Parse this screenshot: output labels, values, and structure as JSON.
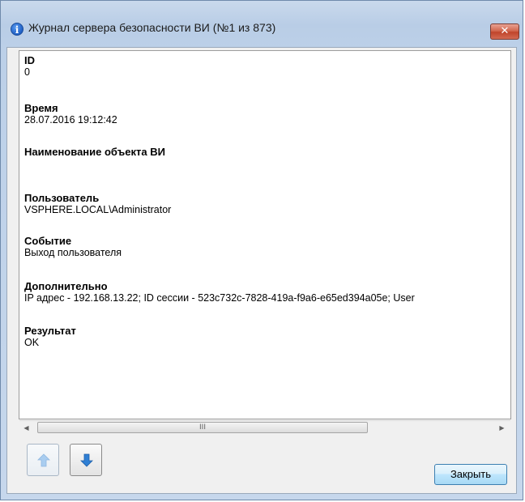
{
  "window": {
    "title": "Журнал сервера безопасности ВИ (№1 из 873)",
    "close_glyph": "✕"
  },
  "record": {
    "fields": [
      {
        "label": "ID",
        "value": "0"
      },
      {
        "label": "Время",
        "value": "28.07.2016 19:12:42"
      },
      {
        "label": "Наименование объекта ВИ",
        "value": ""
      },
      {
        "label": "Пользователь",
        "value": "VSPHERE.LOCAL\\Administrator"
      },
      {
        "label": "Событие",
        "value": "Выход пользователя"
      },
      {
        "label": "Дополнительно",
        "value": "IP адрес - 192.168.13.22; ID сессии - 523c732c-7828-419a-f9a6-e65ed394a05e; User"
      },
      {
        "label": "Результат",
        "value": "OK"
      }
    ]
  },
  "scrollbar": {
    "left_arrow": "◀",
    "right_arrow": "▶",
    "grip": "III"
  },
  "buttons": {
    "close_label": "Закрыть"
  },
  "icons": {
    "title": "info-icon",
    "prev": "arrow-up-icon",
    "next": "arrow-down-icon"
  },
  "colors": {
    "accent_blue": "#2f7fd4",
    "close_red": "#c7452c"
  }
}
